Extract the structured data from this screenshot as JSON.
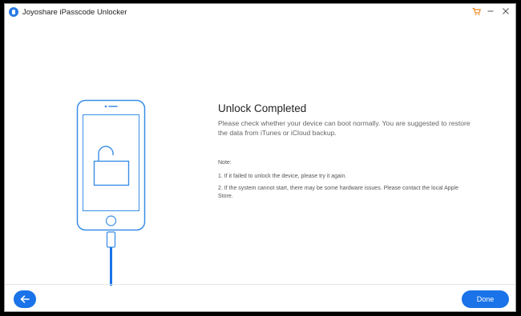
{
  "app": {
    "title": "Joyoshare iPasscode Unlocker",
    "logo_icon": "joyoshare-logo-icon",
    "accent_color": "#1a73e8",
    "window_controls": {
      "cart_icon": "cart-icon",
      "minimize_icon": "minimize-icon",
      "close_icon": "close-icon"
    }
  },
  "main": {
    "illustration": {
      "phone_icon": "iphone-outline-icon",
      "unlock_icon": "unlocked-padlock-icon",
      "cable_icon": "lightning-cable-icon"
    },
    "heading": "Unlock Completed",
    "description": "Please check whether your device can boot normally. You are suggested to restore the data from iTunes or iCloud backup.",
    "note_title": "Note:",
    "notes": [
      "1. If it failed to unlock the device, please try it again.",
      "2. If the system cannot start, there may be some hardware issues. Please contact the local Apple Store."
    ]
  },
  "footer": {
    "back_icon": "arrow-left-icon",
    "done_label": "Done"
  }
}
